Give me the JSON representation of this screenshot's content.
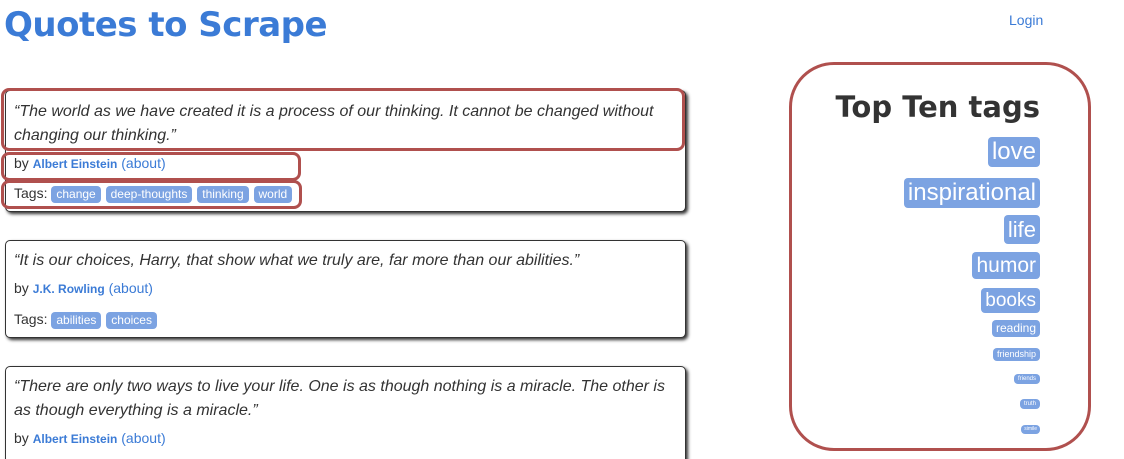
{
  "header": {
    "title": "Quotes to Scrape",
    "login": "Login"
  },
  "quotes": [
    {
      "text": "“The world as we have created it is a process of our thinking. It cannot be changed without changing our thinking.”",
      "by": "by",
      "author": "Albert Einstein",
      "about": "(about)",
      "tags_label": "Tags:",
      "tags": [
        "change",
        "deep-thoughts",
        "thinking",
        "world"
      ]
    },
    {
      "text": "“It is our choices, Harry, that show what we truly are, far more than our abilities.”",
      "by": "by",
      "author": "J.K. Rowling",
      "about": "(about)",
      "tags_label": "Tags:",
      "tags": [
        "abilities",
        "choices"
      ]
    },
    {
      "text": "“There are only two ways to live your life. One is as though nothing is a miracle. The other is as though everything is a miracle.”",
      "by": "by",
      "author": "Albert Einstein",
      "about": "(about)"
    }
  ],
  "sidebar": {
    "title": "Top Ten tags",
    "tags": [
      "love",
      "inspirational",
      "life",
      "humor",
      "books",
      "reading",
      "friendship",
      "friends",
      "truth",
      "simile"
    ]
  },
  "colors": {
    "link": "#3b7bd6",
    "tag_bg": "#7ca3e2",
    "highlight": "#b0504e"
  }
}
